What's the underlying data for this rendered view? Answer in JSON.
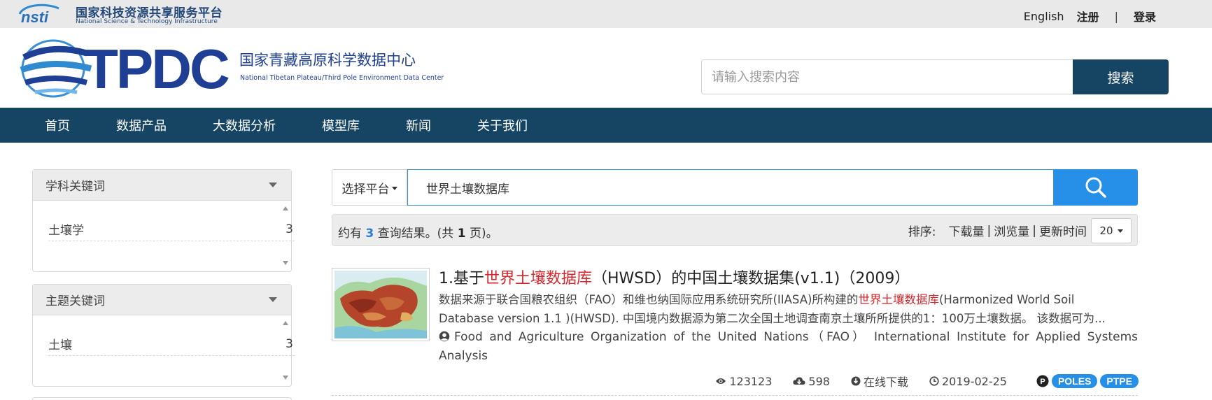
{
  "topbar": {
    "nsti_cn": "国家科技资源共享服务平台",
    "nsti_en": "National Science & Technology Infrastructure",
    "nsti_mark": "nsti",
    "english": "English",
    "register": "注册",
    "separator": "|",
    "login": "登录"
  },
  "header": {
    "logo_text": "TPDC",
    "center_cn": "国家青藏高原科学数据中心",
    "center_en": "National Tibetan Plateau/Third Pole Environment Data Center",
    "search_placeholder": "请输入搜索内容",
    "search_button": "搜索"
  },
  "nav": {
    "items": [
      {
        "label": "首页"
      },
      {
        "label": "数据产品"
      },
      {
        "label": "大数据分析"
      },
      {
        "label": "模型库"
      },
      {
        "label": "新闻"
      },
      {
        "label": "关于我们"
      }
    ]
  },
  "sidebar": {
    "panels": [
      {
        "title": "学科关键词",
        "items": [
          {
            "label": "土壤学",
            "count": "3"
          }
        ]
      },
      {
        "title": "主题关键词",
        "items": [
          {
            "label": "土壤",
            "count": "3"
          }
        ]
      }
    ]
  },
  "search": {
    "platform_label": "选择平台",
    "query": "世界土壤数据库"
  },
  "results": {
    "prefix": "约有",
    "count": "3",
    "middle": "查询结果。(共",
    "pages": "1",
    "suffix": "页)。",
    "sort_label": "排序:",
    "sort_options": [
      "下载量",
      "浏览量",
      "更新时间"
    ],
    "sort_separator": "|",
    "per_page": "20"
  },
  "item": {
    "title_prefix": "1.基于",
    "title_highlight": "世界土壤数据库",
    "title_suffix": "（HWSD）的中国土壤数据集(v1.1)（2009）",
    "desc_part1": "数据来源于联合国粮农组织（FAO）和维也纳国际应用系统研究所(IIASA)所构建的",
    "desc_highlight": "世界土壤数据库",
    "desc_part2": "(Harmonized World Soil",
    "desc_line2": "Database version 1.1 )(HWSD). 中国境内数据源为第二次全国土地调查南京土壤所所提供的1：100万土壤数据。 该数据可为...",
    "authors": "Food and Agriculture Organization of the United Nations（FAO） International Institute for Applied Systems Analysis",
    "views": "123123",
    "downloads": "598",
    "download_mode": "在线下载",
    "date": "2019-02-25",
    "p_badge": "P",
    "tags": [
      "POLES",
      "PTPE"
    ]
  },
  "colors": {
    "nav_bg": "#164463",
    "accent_blue": "#268fe8",
    "highlight_red": "#d6262b",
    "logo_blue": "#1f3f94"
  }
}
